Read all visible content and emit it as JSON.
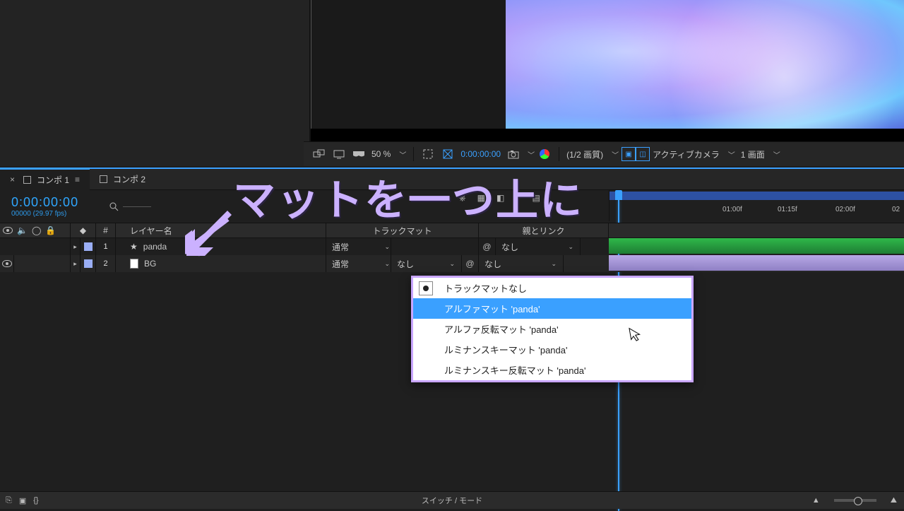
{
  "preview_toolbar": {
    "zoom": "50 %",
    "timecode": "0:00:00:00",
    "quality": "(1/2 画質)",
    "camera": "アクティブカメラ",
    "views": "1 画面"
  },
  "timeline": {
    "tabs": [
      {
        "label": "コンポ 1",
        "active": true
      },
      {
        "label": "コンポ 2",
        "active": false
      }
    ],
    "current_time": "0:00:00:00",
    "frame_info": "00000 (29.97 fps)",
    "columns": {
      "number": "#",
      "layer_name": "レイヤー名",
      "track_matte": "トラックマット",
      "parent_link": "親とリンク"
    },
    "mode_column_value": "通常",
    "matte_column_value": "なし",
    "parent_value": "なし",
    "layers": [
      {
        "index": "1",
        "name": "panda",
        "icon": "star",
        "visible": false
      },
      {
        "index": "2",
        "name": "BG",
        "icon": "file",
        "visible": true
      }
    ],
    "ruler_ticks": [
      "01:00f",
      "01:15f",
      "02:00f",
      "02"
    ]
  },
  "context_menu": {
    "items": [
      {
        "label": "トラックマットなし",
        "checked": true,
        "selected": false
      },
      {
        "label": "アルファマット 'panda'",
        "checked": false,
        "selected": true
      },
      {
        "label": "アルファ反転マット 'panda'",
        "checked": false,
        "selected": false
      },
      {
        "label": "ルミナンスキーマット 'panda'",
        "checked": false,
        "selected": false
      },
      {
        "label": "ルミナンスキー反転マット 'panda'",
        "checked": false,
        "selected": false
      }
    ]
  },
  "overlay_annotation": "マットを一つ上に",
  "bottom_bar": {
    "switch_mode": "スイッチ / モード"
  }
}
